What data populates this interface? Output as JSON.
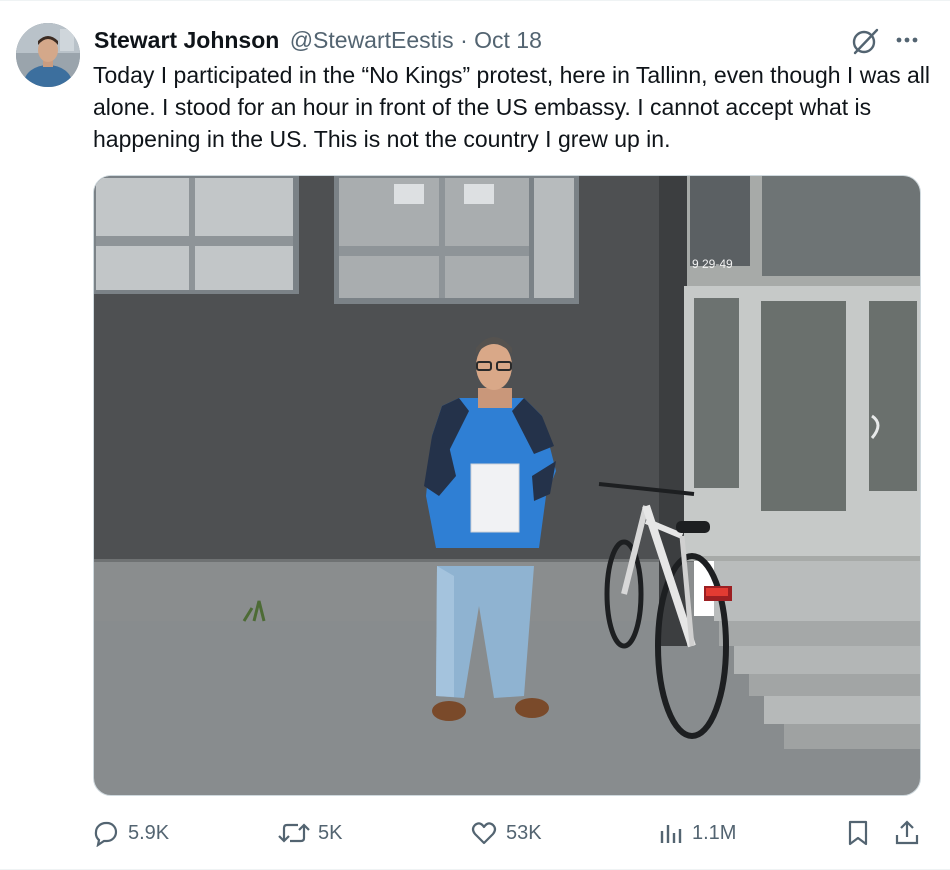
{
  "tweet": {
    "author_name": "Stewart Johnson",
    "handle": "@StewartEestis",
    "separator": "·",
    "date": "Oct 18",
    "text": "Today I participated in the “No Kings” protest, here in Tallinn, even though I was all alone. I stood for an hour in front of the US embassy. I cannot accept what is happening in the US. This is not the country I grew up in."
  },
  "media": {
    "door_sign": "9 29-49"
  },
  "actions": {
    "replies": "5.9K",
    "reposts": "5K",
    "likes": "53K",
    "views": "1.1M"
  },
  "icons": {
    "reply": "reply-icon",
    "repost": "repost-icon",
    "like": "like-icon",
    "views": "views-icon",
    "bookmark": "bookmark-icon",
    "share": "share-icon",
    "grok": "grok-icon",
    "more": "more-icon"
  },
  "colors": {
    "text_primary": "#0f1419",
    "text_secondary": "#536471",
    "border": "#cfd9de"
  }
}
